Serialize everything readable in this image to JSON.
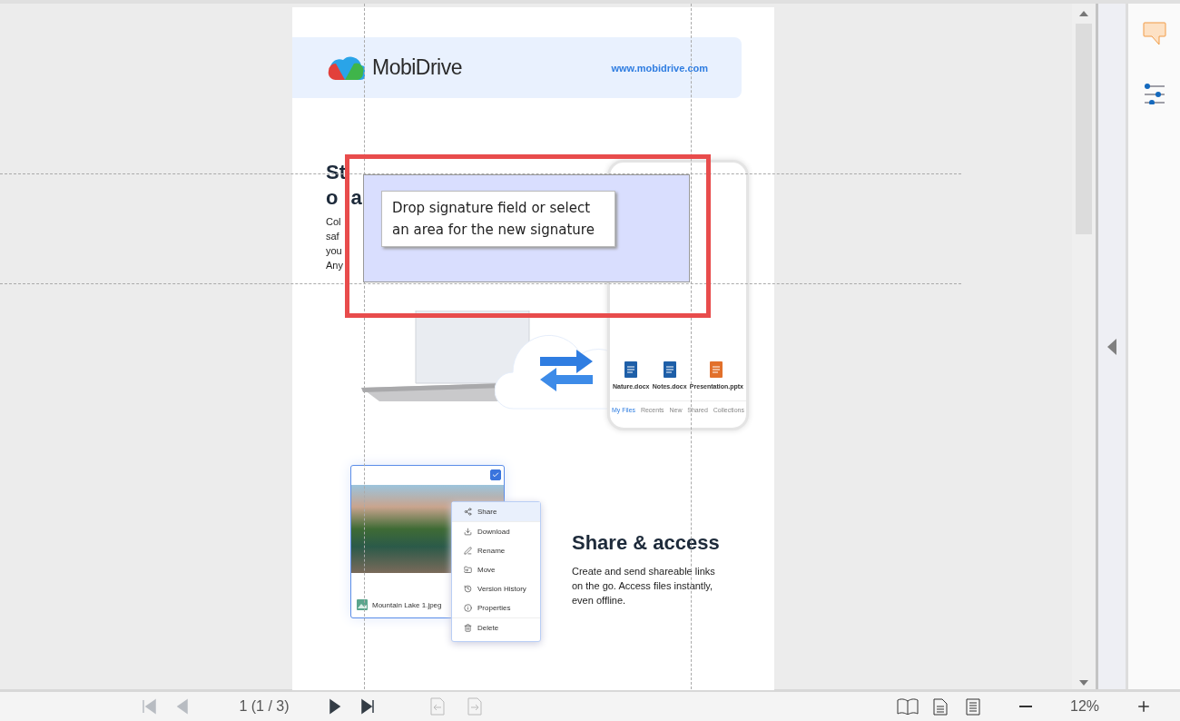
{
  "document": {
    "brand": "MobiDrive",
    "url": "www.mobidrive.com",
    "section_1": {
      "heading_lines": [
        [
          "St"
        ],
        [
          "o",
          "a"
        ]
      ],
      "body_lines": [
        "Col",
        "saf",
        "you",
        "Any"
      ],
      "phone": {
        "files": [
          "Nature.docx",
          "Notes.docx",
          "Presentation.pptx"
        ],
        "tabs": [
          {
            "label": "My Files",
            "selected": true
          },
          {
            "label": "Recents",
            "selected": false
          },
          {
            "label": "New",
            "selected": false
          },
          {
            "label": "Shared",
            "selected": false
          },
          {
            "label": "Collections",
            "selected": false
          }
        ]
      }
    },
    "section_2": {
      "file_card": {
        "name": "Mountain Lake 1.jpeg",
        "checked": true
      },
      "menu": [
        {
          "label": "Share",
          "selected": true
        },
        {
          "label": "Download",
          "selected": false
        },
        {
          "label": "Rename",
          "selected": false
        },
        {
          "label": "Move",
          "selected": false
        },
        {
          "label": "Version History",
          "selected": false
        },
        {
          "label": "Properties",
          "selected": false
        },
        {
          "label": "Delete",
          "selected": false
        }
      ],
      "heading": "Share & access",
      "body": "Create and send shareable links on the go. Access files instantly, even offline."
    }
  },
  "signature_hint": "Drop signature field or select an area for the new signature",
  "toolbar": {
    "nav_buttons": [
      {
        "kind": "first",
        "disabled": true
      },
      {
        "kind": "prev",
        "disabled": true
      }
    ],
    "page_indicator": "1 (1 / 3)",
    "nav_buttons_2": [
      {
        "kind": "next",
        "disabled": false
      },
      {
        "kind": "last",
        "disabled": false
      }
    ],
    "zoom": "12%"
  }
}
